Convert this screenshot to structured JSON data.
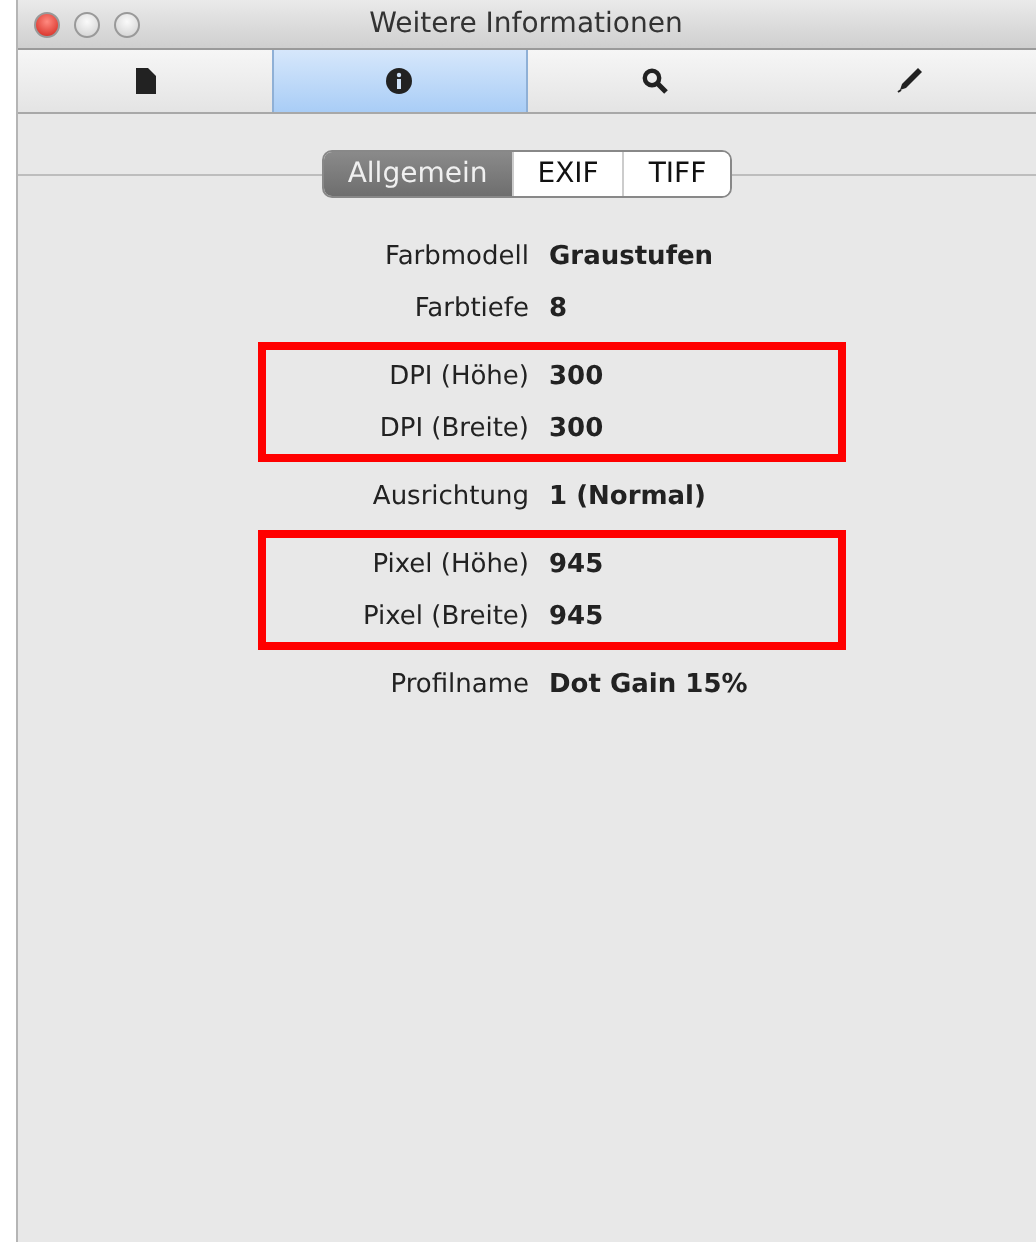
{
  "window": {
    "title": "Weitere Informationen"
  },
  "toolbar": [
    {
      "kind": "document",
      "selected": false
    },
    {
      "kind": "info",
      "selected": true
    },
    {
      "kind": "search",
      "selected": false
    },
    {
      "kind": "pencil",
      "selected": false
    }
  ],
  "segments": [
    {
      "label": "Allgemein",
      "selected": true
    },
    {
      "label": "EXIF",
      "selected": false
    },
    {
      "label": "TIFF",
      "selected": false
    }
  ],
  "groups": [
    {
      "highlighted": false,
      "rows": [
        {
          "label": "Farbmodell",
          "value": "Graustufen"
        },
        {
          "label": "Farbtiefe",
          "value": "8"
        }
      ]
    },
    {
      "highlighted": true,
      "rows": [
        {
          "label": "DPI (Höhe)",
          "value": "300"
        },
        {
          "label": "DPI (Breite)",
          "value": "300"
        }
      ]
    },
    {
      "highlighted": false,
      "rows": [
        {
          "label": "Ausrichtung",
          "value": "1 (Normal)"
        }
      ]
    },
    {
      "highlighted": true,
      "rows": [
        {
          "label": "Pixel (Höhe)",
          "value": "945"
        },
        {
          "label": "Pixel (Breite)",
          "value": "945"
        }
      ]
    },
    {
      "highlighted": false,
      "rows": [
        {
          "label": "Profilname",
          "value": "Dot Gain 15%"
        }
      ]
    }
  ]
}
